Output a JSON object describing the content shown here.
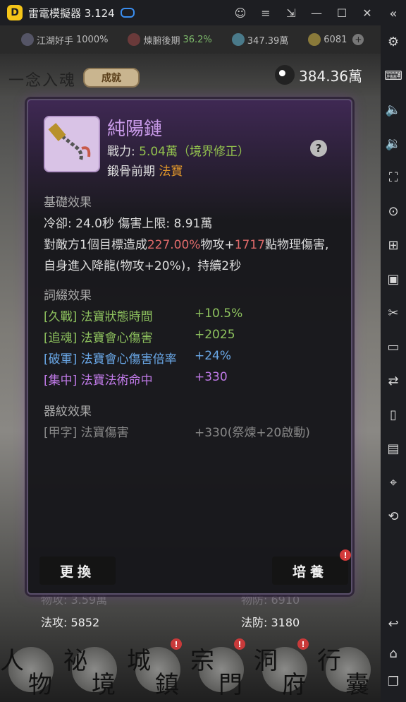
{
  "window": {
    "title": "雷電模擬器 3.124"
  },
  "resources": [
    {
      "label": "江湖好手",
      "value": "1000%"
    },
    {
      "label": "煉腑後期",
      "value": "36.2%"
    },
    {
      "label": "",
      "value": "347.39萬"
    },
    {
      "label": "",
      "value": "6081"
    }
  ],
  "header": {
    "title": "一念入魂",
    "achievement_button": "成就",
    "currency": "384.36萬"
  },
  "item": {
    "name": "純陽鏈",
    "power_label": "戰力:",
    "power_value": "5.04萬（境界修正）",
    "rank_label": "鍛骨前期",
    "rank_type": "法寶"
  },
  "basic_effect": {
    "title": "基礎效果",
    "cooldown": "冷卻:  24.0秒  傷害上限:  8.91萬",
    "desc1_a": "對敵方1個目標造成",
    "desc1_b": "227.00%",
    "desc1_c": "物攻+",
    "desc1_d": "1717",
    "desc1_e": "點物理傷害,",
    "desc2": "自身進入降龍(物攻+20%)，持續2秒"
  },
  "affix_effect": {
    "title": "詞綴效果",
    "items": [
      {
        "name": "[久戰] 法寶狀態時間",
        "value": "+10.5%"
      },
      {
        "name": "[追魂] 法寶會心傷害",
        "value": "+2025"
      },
      {
        "name": "[破軍] 法寶會心傷害倍率",
        "value": "+24%"
      },
      {
        "name": "[集中] 法寶法術命中",
        "value": "+330"
      }
    ]
  },
  "pattern_effect": {
    "title": "器紋效果",
    "items": [
      {
        "name": "[甲字] 法寶傷害",
        "value": "+330(祭煉+20啟動)"
      }
    ]
  },
  "buttons": {
    "replace": "更換",
    "cultivate": "培養"
  },
  "stats": {
    "phys_atk": "物攻:  3.59萬",
    "phys_def": "物防:  6910",
    "mag_atk_label": "法攻:",
    "mag_atk": "5852",
    "mag_def_label": "法防:",
    "mag_def": "3180"
  },
  "nav": [
    {
      "c1": "人",
      "c2": "物"
    },
    {
      "c1": "祕",
      "c2": "境"
    },
    {
      "c1": "城",
      "c2": "鎮"
    },
    {
      "c1": "宗",
      "c2": "門"
    },
    {
      "c1": "洞",
      "c2": "府"
    },
    {
      "c1": "行",
      "c2": "囊"
    }
  ],
  "alerts": {
    "mark": "!"
  },
  "colors": {
    "item_name": "#c89ae8",
    "highlight_red": "#e06a6a",
    "affix_green": "#8ec25e",
    "affix_blue": "#6aa8e8",
    "affix_purple": "#c07ae8",
    "rank_orange": "#e0962a"
  }
}
